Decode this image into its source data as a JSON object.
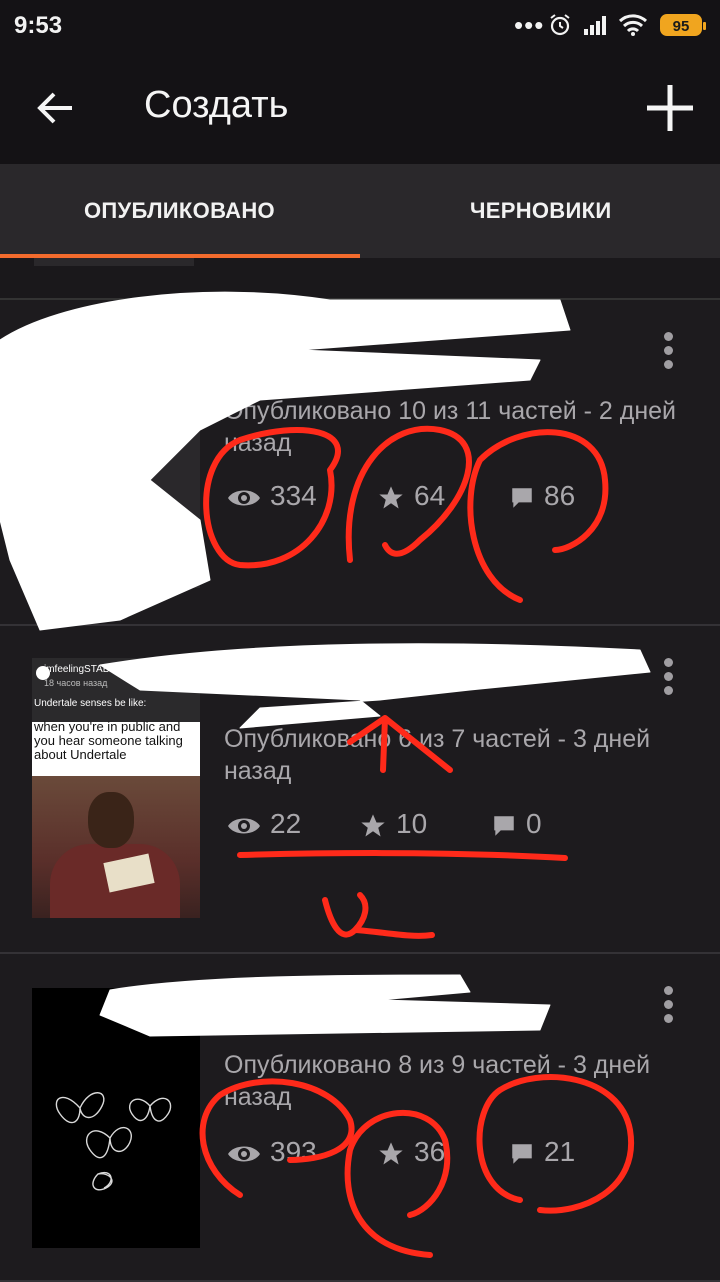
{
  "status_bar": {
    "time": "9:53",
    "dots": "•••",
    "battery": "95",
    "icons": [
      "alarm-icon",
      "signal-icon",
      "wifi-icon",
      "battery-icon"
    ]
  },
  "app_bar": {
    "title": "Создать",
    "icons": [
      "back-arrow-icon",
      "plus-icon"
    ]
  },
  "tabs": [
    {
      "label": "ОПУБЛИКОВАНО",
      "active": true
    },
    {
      "label": "ЧЕРНОВИКИ",
      "active": false
    }
  ],
  "colors": {
    "accent": "#f36b2d",
    "background": "#1d1b1e",
    "bar": "#141215",
    "scribble_red": "#ff2a1a",
    "redaction": "#ffffff"
  },
  "stories": [
    {
      "published": "Опубликовано 10 из 11 частей - 2 дней назад",
      "views": "334",
      "votes": "64",
      "comments": "86"
    },
    {
      "published": "Опубликовано 6 из 7 частей - 3 дней назад",
      "views": "22",
      "votes": "10",
      "comments": "0",
      "thumbnail": {
        "user": "imfeelingSTAB",
        "ago": "18 часов назад",
        "senses": "Undertale senses be like:",
        "caption": "when you're in public and you hear someone talking about Undertale"
      }
    },
    {
      "published": "Опубликовано 8 из 9 частей - 3 дней назад",
      "views": "393",
      "votes": "36",
      "comments": "21"
    }
  ]
}
